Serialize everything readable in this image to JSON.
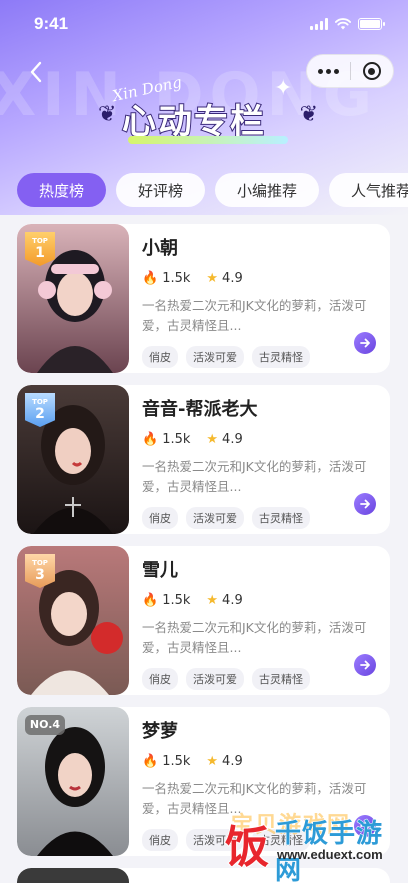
{
  "status_bar": {
    "time": "9:41"
  },
  "banner": {
    "script": "Xin Dong",
    "title": "心动专栏",
    "watermark": "XIN DONG ZHUAN"
  },
  "tabs": [
    {
      "label": "热度榜",
      "active": true
    },
    {
      "label": "好评榜",
      "active": false
    },
    {
      "label": "小编推荐",
      "active": false
    },
    {
      "label": "人气推荐",
      "active": false
    }
  ],
  "cards": [
    {
      "rank_top": "TOP",
      "rank_num": "1",
      "rank_style": "gold",
      "name": "小朝",
      "heat": "1.5k",
      "rating": "4.9",
      "description": "一名热爱二次元和JK文化的萝莉，活泼可爱，古灵精怪且...",
      "tags": [
        "俏皮",
        "活泼可爱",
        "古灵精怪"
      ]
    },
    {
      "rank_top": "TOP",
      "rank_num": "2",
      "rank_style": "silver",
      "name": "音音-帮派老大",
      "heat": "1.5k",
      "rating": "4.9",
      "description": "一名热爱二次元和JK文化的萝莉，活泼可爱，古灵精怪且...",
      "tags": [
        "俏皮",
        "活泼可爱",
        "古灵精怪"
      ]
    },
    {
      "rank_top": "TOP",
      "rank_num": "3",
      "rank_style": "bronze",
      "name": "雪儿",
      "heat": "1.5k",
      "rating": "4.9",
      "description": "一名热爱二次元和JK文化的萝莉，活泼可爱，古灵精怪且...",
      "tags": [
        "俏皮",
        "活泼可爱",
        "古灵精怪"
      ]
    },
    {
      "rank_top": "",
      "rank_num": "NO.4",
      "rank_style": "plain",
      "name": "梦萝",
      "heat": "1.5k",
      "rating": "4.9",
      "description": "一名热爱二次元和JK文化的萝莉，活泼可爱，古灵精怪且...",
      "tags": [
        "俏皮",
        "活泼可爱",
        "古灵精怪"
      ]
    }
  ],
  "watermark": {
    "logo": "饭",
    "ghost": "宝贝游戏网",
    "main": "千饭手游网",
    "url": "www.eduext.com"
  },
  "colors": {
    "accent": "#8460f2",
    "flame": "#f0573c",
    "star": "#f5b92e"
  }
}
